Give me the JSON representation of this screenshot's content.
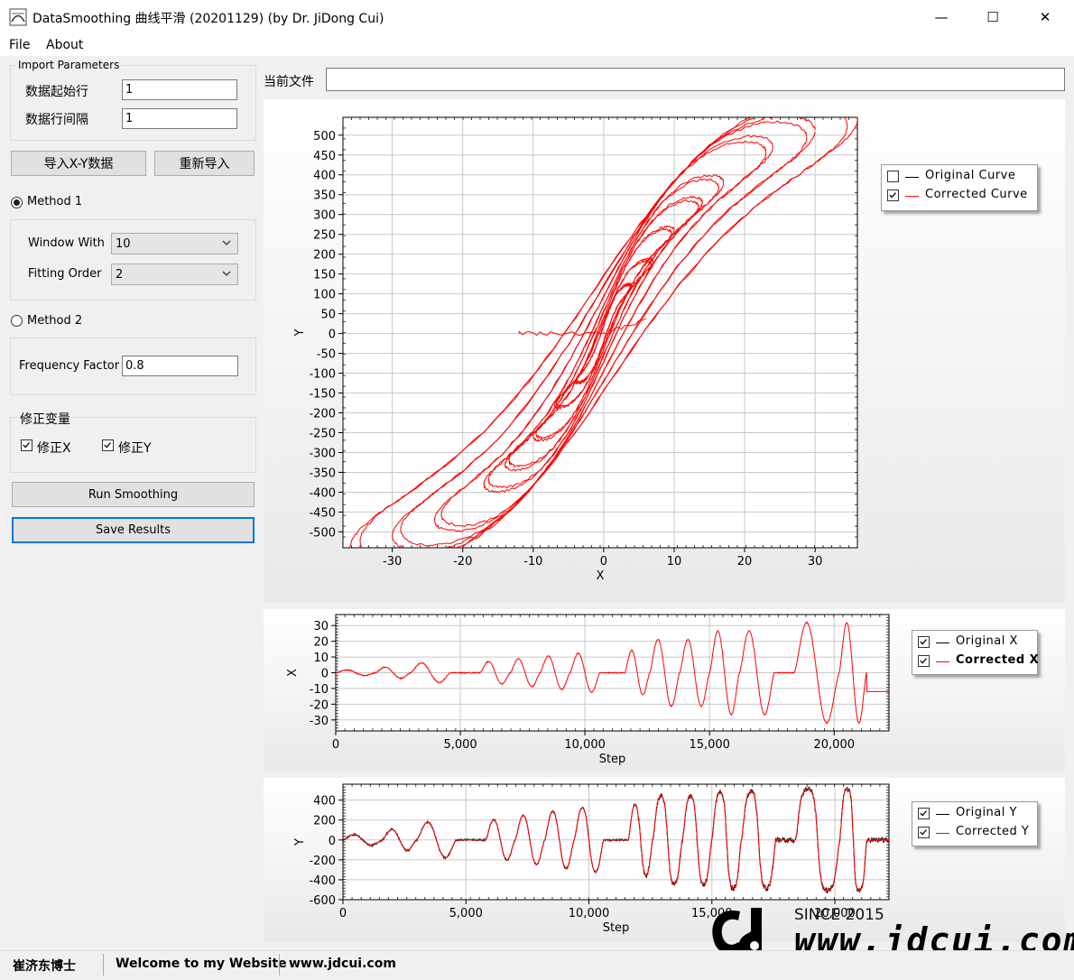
{
  "window": {
    "title": "DataSmoothing 曲线平滑 (20201129) (by Dr. JiDong Cui)",
    "minimize_glyph": "—",
    "maximize_glyph": "☐",
    "close_glyph": "✕"
  },
  "menu": [
    "File",
    "About"
  ],
  "import_params": {
    "title": "Import Parameters",
    "start_row_label": "数据起始行",
    "start_row_value": "1",
    "row_interval_label": "数据行间隔",
    "row_interval_value": "1"
  },
  "buttons": {
    "import_xy": "导入X-Y数据",
    "reimport": "重新导入",
    "run": "Run Smoothing",
    "save": "Save Results"
  },
  "method1": {
    "label": "Method 1",
    "selected": true,
    "window_label": "Window With",
    "window_value": "10",
    "order_label": "Fitting Order",
    "order_value": "2"
  },
  "method2": {
    "label": "Method 2",
    "selected": false,
    "freq_label": "Frequency Factor",
    "freq_value": "0.8"
  },
  "correction": {
    "title": "修正变量",
    "fix_x_label": "修正X",
    "fix_x_checked": true,
    "fix_y_label": "修正Y",
    "fix_y_checked": true
  },
  "current_file": {
    "label": "当前文件",
    "value": ""
  },
  "colors": {
    "corrected": "#ff0000",
    "original": "#000000",
    "focus_blue": "#0078d7"
  },
  "chart_data": [
    {
      "type": "line",
      "name": "hysteresis",
      "xlabel": "X",
      "ylabel": "Y",
      "xlim": [
        -37,
        36
      ],
      "ylim": [
        -540,
        545
      ],
      "xticks": [
        -30,
        -20,
        -10,
        0,
        10,
        20,
        30
      ],
      "yticks": [
        500,
        450,
        400,
        350,
        300,
        250,
        200,
        150,
        100,
        50,
        0,
        -50,
        -100,
        -150,
        -200,
        -250,
        -300,
        -350,
        -400,
        -450,
        -500
      ],
      "grid": true,
      "legend_position": "right",
      "legend": [
        {
          "label": "Original Curve",
          "checked": false,
          "color": "#000000"
        },
        {
          "label": "Corrected Curve",
          "checked": true,
          "color": "#ff0000"
        }
      ],
      "loops": [
        {
          "amp_x": 4,
          "amp_y": 120,
          "width": 40
        },
        {
          "amp_x": 7,
          "amp_y": 180,
          "width": 60
        },
        {
          "amp_x": 10,
          "amp_y": 260,
          "width": 80
        },
        {
          "amp_x": 14,
          "amp_y": 330,
          "width": 110
        },
        {
          "amp_x": 17,
          "amp_y": 380,
          "width": 140
        },
        {
          "amp_x": 24,
          "amp_y": 470,
          "width": 190
        },
        {
          "amp_x": 30,
          "amp_y": 510,
          "width": 240
        },
        {
          "amp_x": 36,
          "amp_y": 540,
          "width": 290
        }
      ]
    },
    {
      "type": "line",
      "name": "x-history",
      "xlabel": "Step",
      "ylabel": "X",
      "xlim": [
        0,
        22200
      ],
      "ylim": [
        -37,
        37
      ],
      "xticks": [
        0,
        5000,
        10000,
        15000,
        20000
      ],
      "xtick_labels": [
        "0",
        "5,000",
        "10,000",
        "15,000",
        "20,000"
      ],
      "yticks": [
        30,
        20,
        10,
        0,
        -10,
        -20,
        -30
      ],
      "grid": true,
      "legend_position": "right",
      "legend": [
        {
          "label": "Original X",
          "checked": true,
          "color": "#000000"
        },
        {
          "label": "Corrected X",
          "checked": true,
          "color": "#ff0000"
        }
      ],
      "cycles": [
        {
          "start": 0,
          "end": 1600,
          "amp": 2
        },
        {
          "start": 1600,
          "end": 3000,
          "amp": 4
        },
        {
          "start": 3000,
          "end": 4600,
          "amp": 7
        },
        {
          "start": 4600,
          "end": 5800,
          "amp": 0
        },
        {
          "start": 5800,
          "end": 7000,
          "amp": 8
        },
        {
          "start": 7000,
          "end": 8200,
          "amp": 10
        },
        {
          "start": 8200,
          "end": 9400,
          "amp": 12
        },
        {
          "start": 9400,
          "end": 10600,
          "amp": 14
        },
        {
          "start": 10600,
          "end": 11600,
          "amp": 0
        },
        {
          "start": 11600,
          "end": 12600,
          "amp": 16
        },
        {
          "start": 12600,
          "end": 13800,
          "amp": 24
        },
        {
          "start": 13800,
          "end": 15000,
          "amp": 24
        },
        {
          "start": 15000,
          "end": 16200,
          "amp": 30
        },
        {
          "start": 16200,
          "end": 17600,
          "amp": 30
        },
        {
          "start": 17600,
          "end": 18400,
          "amp": 0
        },
        {
          "start": 18400,
          "end": 20200,
          "amp": 36
        },
        {
          "start": 20200,
          "end": 21300,
          "amp": 36
        },
        {
          "start": 21300,
          "end": 22200,
          "amp": 0
        }
      ]
    },
    {
      "type": "line",
      "name": "y-history",
      "xlabel": "Step",
      "ylabel": "Y",
      "xlim": [
        0,
        22200
      ],
      "ylim": [
        -600,
        560
      ],
      "xticks": [
        0,
        5000,
        10000,
        15000,
        20000
      ],
      "xtick_labels": [
        "0",
        "5,000",
        "10,000",
        "15,000",
        "20,000"
      ],
      "yticks": [
        400,
        200,
        0,
        -200,
        -400,
        -600
      ],
      "grid": true,
      "legend_position": "right",
      "legend": [
        {
          "label": "Original Y",
          "checked": true,
          "color": "#000000"
        },
        {
          "label": "Corrected Y",
          "checked": true,
          "color": "#ff0000"
        }
      ]
    }
  ],
  "watermark": {
    "since": "SINCE 2015",
    "url": "www.jdcui.com"
  },
  "status": {
    "author": "崔济东博士",
    "welcome": "Welcome to my Website",
    "site": "www.jdcui.com"
  }
}
